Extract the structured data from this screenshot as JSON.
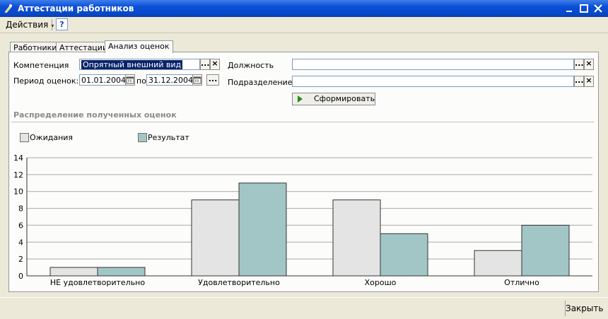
{
  "window": {
    "title": "Аттестации работников",
    "minimize_icon": "minimize-icon",
    "maximize_icon": "maximize-icon",
    "close_icon": "close-icon"
  },
  "toolbar": {
    "actions_label": "Действия",
    "help_label": "?"
  },
  "tabs": [
    {
      "label": "Работники",
      "active": false
    },
    {
      "label": "Аттестации",
      "active": false
    },
    {
      "label": "Анализ оценок",
      "active": true
    }
  ],
  "filters": {
    "competence_label": "Компетенция",
    "competence_value": "Опрятный внешний вид",
    "period_label": "Период оценок:",
    "period_from": "01.01.2004",
    "period_to_label": "по:",
    "period_to": "31.12.2004",
    "position_label": "Должность",
    "position_value": "",
    "department_label": "Подразделение",
    "department_value": "",
    "ellipsis": "...",
    "clear": "×",
    "generate_button": "Сформировать"
  },
  "section": {
    "title": "Распределение полученных оценок"
  },
  "colors": {
    "expected": "#E4E4E4",
    "result": "#A2C6C6",
    "grid": "#A9A9A9"
  },
  "chart_data": {
    "type": "bar",
    "categories": [
      "НЕ удовлетворительно",
      "Удовлетворительно",
      "Хорошо",
      "Отлично"
    ],
    "series": [
      {
        "name": "Ожидания",
        "values": [
          1,
          9,
          9,
          3
        ]
      },
      {
        "name": "Результат",
        "values": [
          1,
          11,
          5,
          6
        ]
      }
    ],
    "ylim": [
      0,
      14
    ],
    "yticks": [
      0,
      2,
      4,
      6,
      8,
      10,
      12,
      14
    ],
    "grid": true,
    "legend_position": "top-left"
  },
  "statusbar": {
    "close_label": "Закрыть"
  }
}
